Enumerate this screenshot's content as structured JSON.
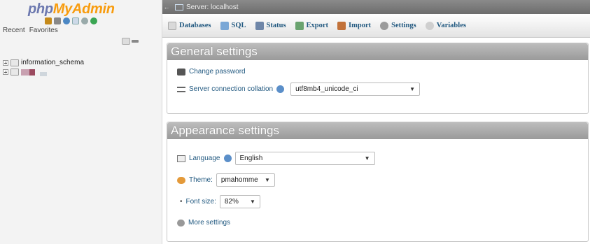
{
  "nav": {
    "logo_php": "php",
    "logo_myadmin": "MyAdmin",
    "quick_icons": [
      "home-icon",
      "exit-icon",
      "docs-icon",
      "sql-docs-icon",
      "settings-icon",
      "reload-icon"
    ],
    "recent": "Recent",
    "favorites": "Favorites",
    "databases": [
      {
        "name": "information_schema"
      },
      {
        "name": ""
      }
    ]
  },
  "serverbar": {
    "label": "Server: localhost"
  },
  "tabs": [
    {
      "label": "Databases",
      "icon": "databases-icon",
      "color": "#d9d9d9"
    },
    {
      "label": "SQL",
      "icon": "sql-icon",
      "color": "#7aa7d6"
    },
    {
      "label": "Status",
      "icon": "status-icon",
      "color": "#6e86a8"
    },
    {
      "label": "Export",
      "icon": "export-icon",
      "color": "#6aa36f"
    },
    {
      "label": "Import",
      "icon": "import-icon",
      "color": "#c2723a"
    },
    {
      "label": "Settings",
      "icon": "wrench-icon",
      "color": "#9b9b9b"
    },
    {
      "label": "Variables",
      "icon": "variables-icon",
      "color": "#cfcfcf"
    }
  ],
  "general": {
    "title": "General settings",
    "change_password": "Change password",
    "collation_label": "Server connection collation",
    "collation_value": "utf8mb4_unicode_ci"
  },
  "appearance": {
    "title": "Appearance settings",
    "language_label": "Language",
    "language_value": "English",
    "theme_label": "Theme:",
    "theme_value": "pmahomme",
    "font_label": "Font size:",
    "font_value": "82%",
    "more_settings": "More settings"
  }
}
